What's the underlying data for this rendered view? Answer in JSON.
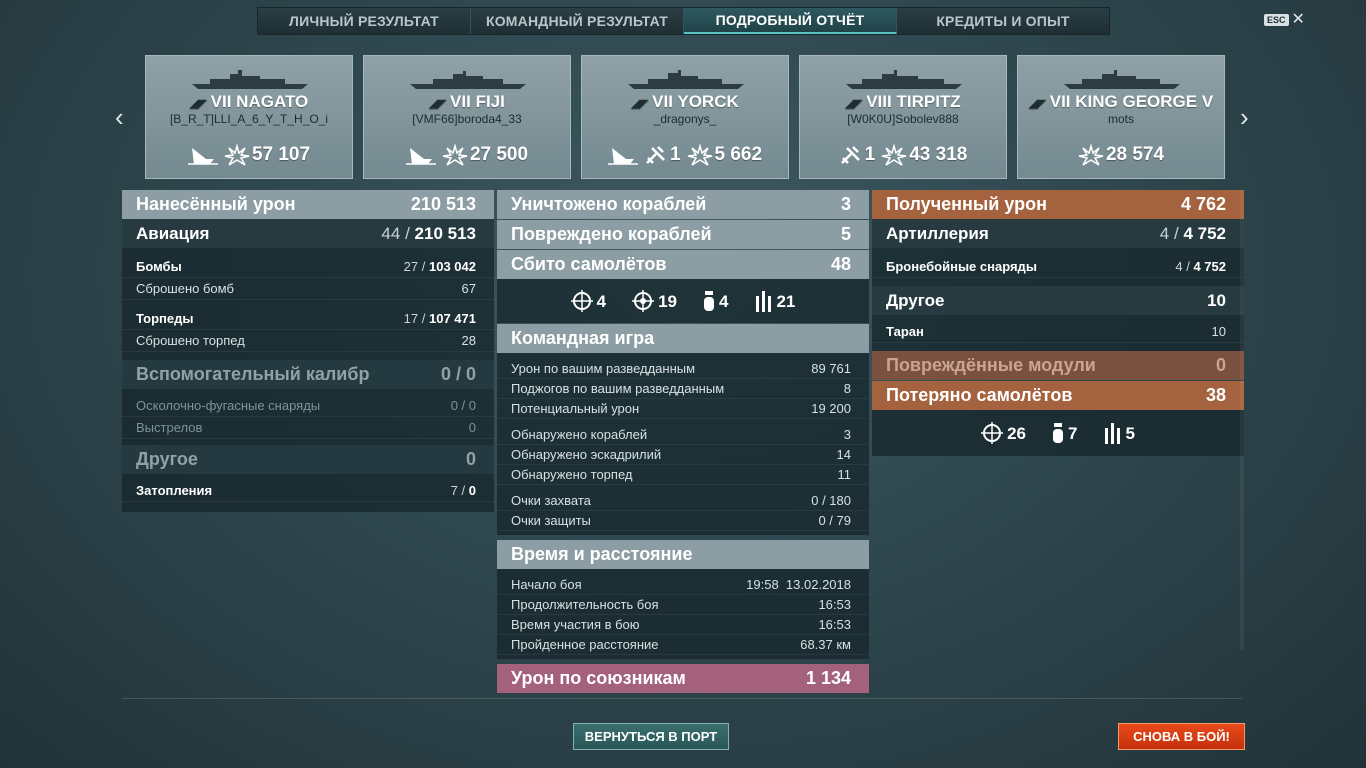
{
  "tabs": [
    {
      "label": "ЛИЧНЫЙ РЕЗУЛЬТАТ"
    },
    {
      "label": "КОМАНДНЫЙ РЕЗУЛЬТАТ"
    },
    {
      "label": "ПОДРОБНЫЙ ОТЧЁТ"
    },
    {
      "label": "КРЕДИТЫ И ОПЫТ"
    }
  ],
  "esc": {
    "key": "ESC",
    "close": "✕"
  },
  "nav": {
    "prev": "‹",
    "next": "›"
  },
  "ships": [
    {
      "tier": "VII",
      "name": "NAGATO",
      "player": "[B_R_T]LLI_A_6_Y_T_H_O_i",
      "planes": "",
      "damage": "57 107"
    },
    {
      "tier": "VII",
      "name": "FIJI",
      "player": "[VMF66]boroda4_33",
      "planes": "",
      "damage": "27 500"
    },
    {
      "tier": "VII",
      "name": "YORCK",
      "player": "_dragonys_",
      "planes": "1",
      "damage": "5 662"
    },
    {
      "tier": "VIII",
      "name": "TIRPITZ",
      "player": "[W0K0U]Sobolev888",
      "planes": "1",
      "damage": "43 318"
    },
    {
      "tier": "VII",
      "name": "KING GEORGE V",
      "player": "mots",
      "planes": "",
      "damage": "28 574"
    }
  ],
  "damage_dealt": {
    "title": "Нанесённый урон",
    "value": "210 513",
    "aviation": {
      "label": "Авиация",
      "hits": "44",
      "value": "210 513"
    },
    "bombs": {
      "label": "Бомбы",
      "hits": "27",
      "value": "103 042"
    },
    "bombs_dropped": {
      "label": "Сброшено бомб",
      "value": "67"
    },
    "torpedoes": {
      "label": "Торпеды",
      "hits": "17",
      "value": "107 471"
    },
    "torpedoes_dropped": {
      "label": "Сброшено торпед",
      "value": "28"
    },
    "secondary": {
      "label": "Вспомогательный калибр",
      "value": "0 / 0"
    },
    "he_shells": {
      "label": "Осколочно-фугасные снаряды",
      "value": "0 / 0"
    },
    "shots": {
      "label": "Выстрелов",
      "value": "0"
    },
    "other": {
      "label": "Другое",
      "value": "0"
    },
    "flooding": {
      "label": "Затопления",
      "hits": "7",
      "value": "0"
    }
  },
  "kills": {
    "destroyed": {
      "label": "Уничтожено кораблей",
      "value": "3"
    },
    "damaged": {
      "label": "Повреждено кораблей",
      "value": "5"
    },
    "planes_shot": {
      "label": "Сбито самолётов",
      "value": "48"
    },
    "plane_types": [
      {
        "icon": "fighter-icon",
        "value": "4"
      },
      {
        "icon": "dive-bomber-icon",
        "value": "19"
      },
      {
        "icon": "bomb-icon",
        "value": "4"
      },
      {
        "icon": "torpedo-icon",
        "value": "21"
      }
    ]
  },
  "teamplay": {
    "title": "Командная игра",
    "rows": [
      {
        "label": "Урон по вашим разведданным",
        "value": "89 761"
      },
      {
        "label": "Поджогов по вашим разведданным",
        "value": "8"
      },
      {
        "label": "Потенциальный урон",
        "value": "19 200"
      },
      {
        "label": "Обнаружено кораблей",
        "value": "3"
      },
      {
        "label": "Обнаружено эскадрилий",
        "value": "14"
      },
      {
        "label": "Обнаружено торпед",
        "value": "11"
      },
      {
        "label": "Очки захвата",
        "value": "0 / 180"
      },
      {
        "label": "Очки защиты",
        "value": "0 / 79"
      }
    ]
  },
  "time": {
    "title": "Время и расстояние",
    "rows": [
      {
        "label": "Начало боя",
        "value": "19:58  13.02.2018"
      },
      {
        "label": "Продолжительность боя",
        "value": "16:53"
      },
      {
        "label": "Время участия в бою",
        "value": "16:53"
      },
      {
        "label": "Пройденное расстояние",
        "value": "68.37 км"
      }
    ]
  },
  "team_damage": {
    "label": "Урон по союзникам",
    "value": "1 134"
  },
  "damage_received": {
    "title": "Полученный урон",
    "value": "4 762",
    "artillery": {
      "label": "Артиллерия",
      "hits": "4",
      "value": "4 752"
    },
    "ap_shells": {
      "label": "Бронебойные снаряды",
      "hits": "4",
      "value": "4 752"
    },
    "other": {
      "label": "Другое",
      "value": "10"
    },
    "ram": {
      "label": "Таран",
      "value": "10"
    },
    "modules": {
      "label": "Повреждённые модули",
      "value": "0"
    },
    "planes_lost": {
      "label": "Потеряно самолётов",
      "value": "38"
    },
    "plane_types": [
      {
        "icon": "fighter-icon",
        "value": "26"
      },
      {
        "icon": "bomb-icon",
        "value": "7"
      },
      {
        "icon": "torpedo-icon",
        "value": "5"
      }
    ]
  },
  "buttons": {
    "port": "ВЕРНУТЬСЯ В ПОРТ",
    "battle": "СНОВА В БОЙ!"
  },
  "colors": {
    "accent": "#59c3c3",
    "orange": "#a5623e",
    "pink": "#a3617b",
    "battle": "#e84a1a"
  }
}
